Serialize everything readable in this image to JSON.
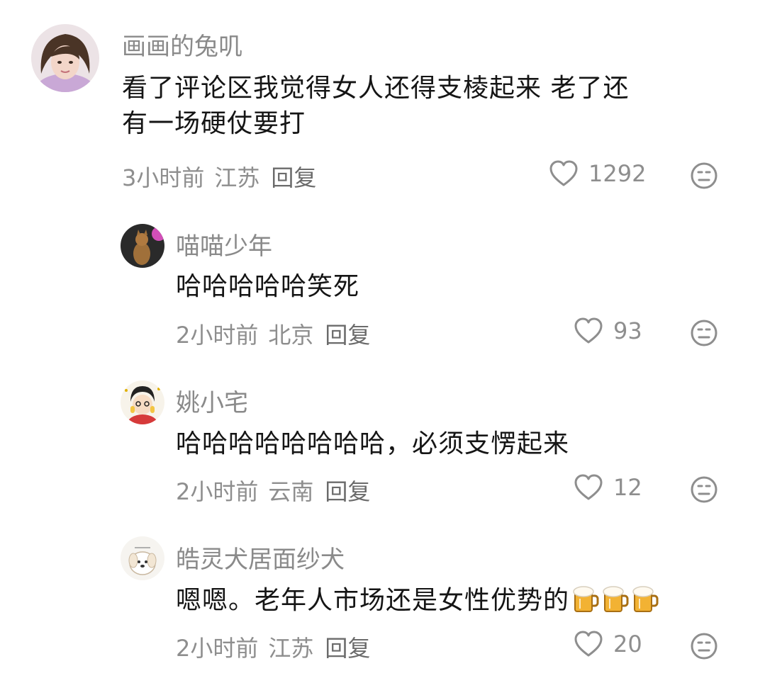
{
  "comments": [
    {
      "username": "画画的兔叽",
      "text_line1": "看了评论区我觉得女人还得支棱起来  老了还",
      "text_line2": "有一场硬仗要打",
      "time": "3小时前",
      "location": "江苏",
      "reply_label": "回复",
      "likes": "1292"
    },
    {
      "username": "喵喵少年",
      "text_line1": "哈哈哈哈哈笑死",
      "time": "2小时前",
      "location": "北京",
      "reply_label": "回复",
      "likes": "93"
    },
    {
      "username": "姚小宅",
      "text_line1": "哈哈哈哈哈哈哈哈，必须支愣起来",
      "time": "2小时前",
      "location": "云南",
      "reply_label": "回复",
      "likes": "12"
    },
    {
      "username": "皓灵犬居面纱犬",
      "text_line1": "嗯嗯。老年人市场还是女性优势的",
      "emoji": [
        "beer-emoji",
        "beer-emoji",
        "beer-emoji"
      ],
      "time": "2小时前",
      "location": "江苏",
      "reply_label": "回复",
      "likes": "20"
    }
  ],
  "colors": {
    "username": "#8a8a8a",
    "text": "#151515",
    "meta": "#8e8e8e",
    "icon": "#8e8e8e"
  }
}
